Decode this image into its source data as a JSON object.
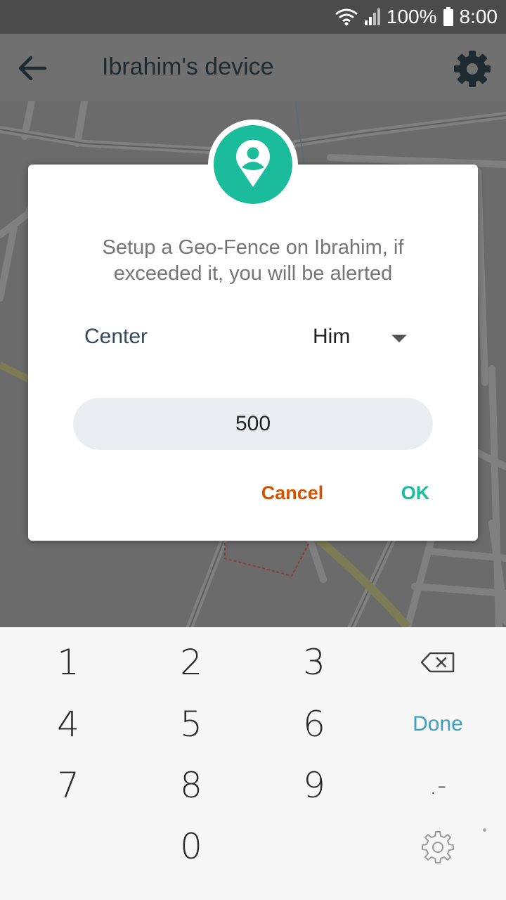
{
  "status_bar": {
    "battery": "100%",
    "time": "8:00"
  },
  "app_bar": {
    "title": "Ibrahim's device"
  },
  "dialog": {
    "message": "Setup a Geo-Fence on Ibrahim, if exceeded it, you will be alerted",
    "center_label": "Center",
    "center_value": "Him",
    "radius_value": "500",
    "cancel_label": "Cancel",
    "ok_label": "OK"
  },
  "keyboard": {
    "row1": [
      "1",
      "2",
      "3"
    ],
    "row2": [
      "4",
      "5",
      "6"
    ],
    "row3": [
      "7",
      "8",
      "9"
    ],
    "zero": "0",
    "done_label": "Done",
    "symbol_label": ".-"
  },
  "colors": {
    "accent": "#1abc9c",
    "cancel": "#d35400",
    "done": "#3d9ec2"
  },
  "icons": [
    "back-arrow-icon",
    "gear-icon",
    "location-pin-icon",
    "backspace-icon",
    "keyboard-settings-icon",
    "wifi-icon",
    "signal-icon",
    "battery-icon"
  ]
}
